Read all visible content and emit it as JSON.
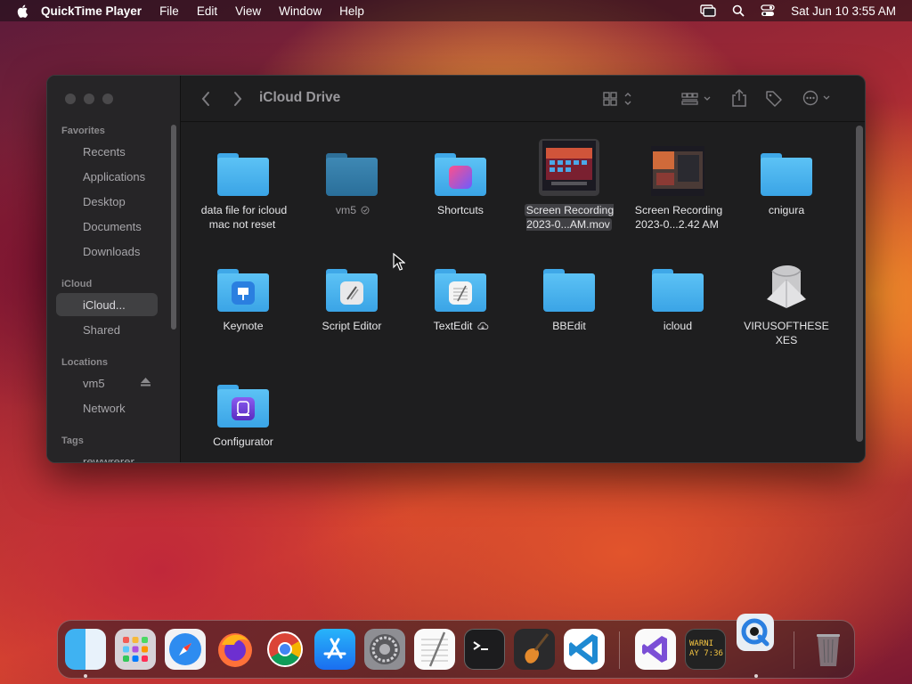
{
  "menubar": {
    "app_name": "QuickTime Player",
    "menus": [
      "File",
      "Edit",
      "View",
      "Window",
      "Help"
    ],
    "datetime": "Sat Jun 10  3:55 AM"
  },
  "window": {
    "title": "iCloud Drive",
    "sidebar": {
      "sections": {
        "favorites": "Favorites",
        "icloud": "iCloud",
        "locations": "Locations",
        "tags": "Tags"
      },
      "favorites": [
        "Recents",
        "Applications",
        "Desktop",
        "Documents",
        "Downloads"
      ],
      "icloud": [
        "iCloud...",
        "Shared"
      ],
      "locations": [
        "vm5",
        "Network"
      ],
      "tags": [
        "rewwrerer"
      ]
    },
    "files": [
      {
        "name": "data file for icloud mac not reset",
        "kind": "folder"
      },
      {
        "name": "vm5",
        "kind": "folder-dim"
      },
      {
        "name": "Shortcuts",
        "kind": "folder-shortcuts"
      },
      {
        "name": "Screen Recording 2023-0...AM.mov",
        "kind": "video",
        "selected": true
      },
      {
        "name": "Screen Recording 2023-0...2.42 AM",
        "kind": "video"
      },
      {
        "name": "cnigura",
        "kind": "folder"
      },
      {
        "name": "Keynote",
        "kind": "folder-keynote"
      },
      {
        "name": "Script Editor",
        "kind": "folder-script"
      },
      {
        "name": "TextEdit",
        "kind": "folder-textedit"
      },
      {
        "name": "BBEdit",
        "kind": "folder"
      },
      {
        "name": "icloud",
        "kind": "folder"
      },
      {
        "name": "VIRUSOFTHESEXES",
        "kind": "script-file"
      },
      {
        "name": "Configurator",
        "kind": "folder-configurator"
      }
    ]
  },
  "dock": {
    "apps": [
      "Finder",
      "Launchpad",
      "Safari",
      "Firefox",
      "Chrome",
      "App Store",
      "System Settings",
      "TextEdit",
      "Terminal",
      "GarageBand",
      "Visual Studio Code",
      "Visual Studio",
      "Console",
      "QuickTime Player",
      "Trash"
    ],
    "console_text": "WARNI\nAY 7:36"
  }
}
